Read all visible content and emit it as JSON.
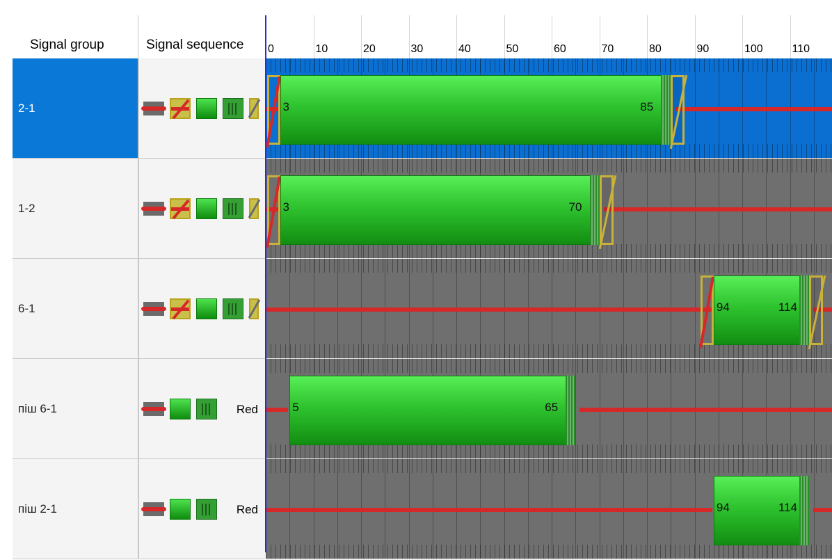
{
  "columns": {
    "group": "Signal group",
    "sequence": "Signal sequence"
  },
  "timeline": {
    "ticks": [
      "0",
      "10",
      "20",
      "30",
      "40",
      "50",
      "60",
      "70",
      "80",
      "90",
      "100",
      "110"
    ]
  },
  "rows": [
    {
      "group": "2-1",
      "seq_label": "",
      "selected": true,
      "green_start": 3,
      "green_end": 85,
      "start_label": "3",
      "end_label": "85"
    },
    {
      "group": "1-2",
      "seq_label": "",
      "selected": false,
      "green_start": 3,
      "green_end": 70,
      "start_label": "3",
      "end_label": "70"
    },
    {
      "group": "6-1",
      "seq_label": "",
      "selected": false,
      "green_start": 94,
      "green_end": 114,
      "start_label": "94",
      "end_label": "114"
    },
    {
      "group": "піш 6-1",
      "seq_label": "Red",
      "selected": false,
      "green_start": 5,
      "green_end": 65,
      "start_label": "5",
      "end_label": "65"
    },
    {
      "group": "піш 2-1",
      "seq_label": "Red",
      "selected": false,
      "green_start": 94,
      "green_end": 114,
      "start_label": "94",
      "end_label": "114"
    }
  ],
  "colors": {
    "selected": "#0a78d7",
    "green": "#2fc32f",
    "red": "#d62828",
    "amber": "#c9b23a",
    "lane": "#6f6f6f"
  }
}
